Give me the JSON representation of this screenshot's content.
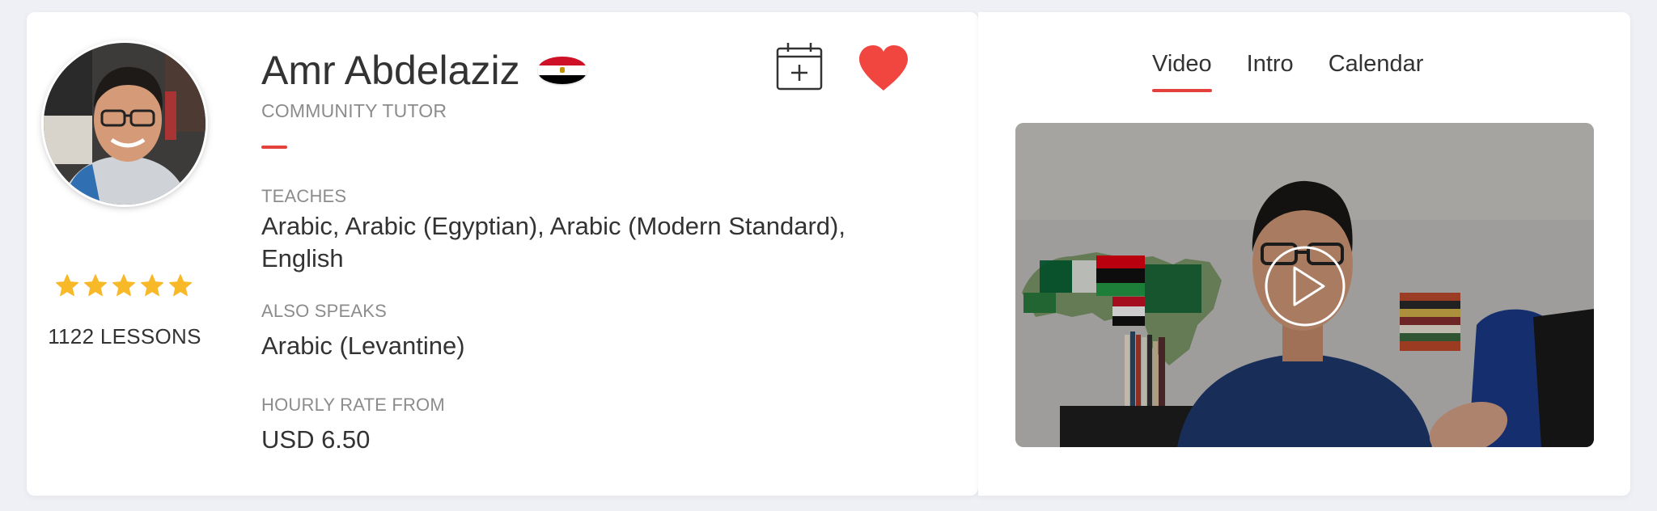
{
  "tutor": {
    "name": "Amr Abdelaziz",
    "role": "COMMUNITY TUTOR",
    "rating_stars": 5,
    "lessons": "1122 LESSONS",
    "flag_country": "Egypt"
  },
  "sections": {
    "teaches_label": "TEACHES",
    "teaches_line1": "Arabic, Arabic (Egyptian), Arabic (Modern Standard),",
    "teaches_line2": "English",
    "also_speaks_label": "ALSO SPEAKS",
    "also_speaks_value": "Arabic (Levantine)",
    "rate_label": "HOURLY RATE FROM",
    "rate_value": "USD 6.50"
  },
  "actions": {
    "calendar_icon": "calendar-add-icon",
    "favorite_icon": "heart-icon"
  },
  "media_tabs": [
    {
      "label": "Video",
      "active": true
    },
    {
      "label": "Intro",
      "active": false
    },
    {
      "label": "Calendar",
      "active": false
    }
  ],
  "colors": {
    "accent": "#e5413c",
    "heart": "#f0463f",
    "star": "#f7b928",
    "background": "#eef0f5"
  }
}
